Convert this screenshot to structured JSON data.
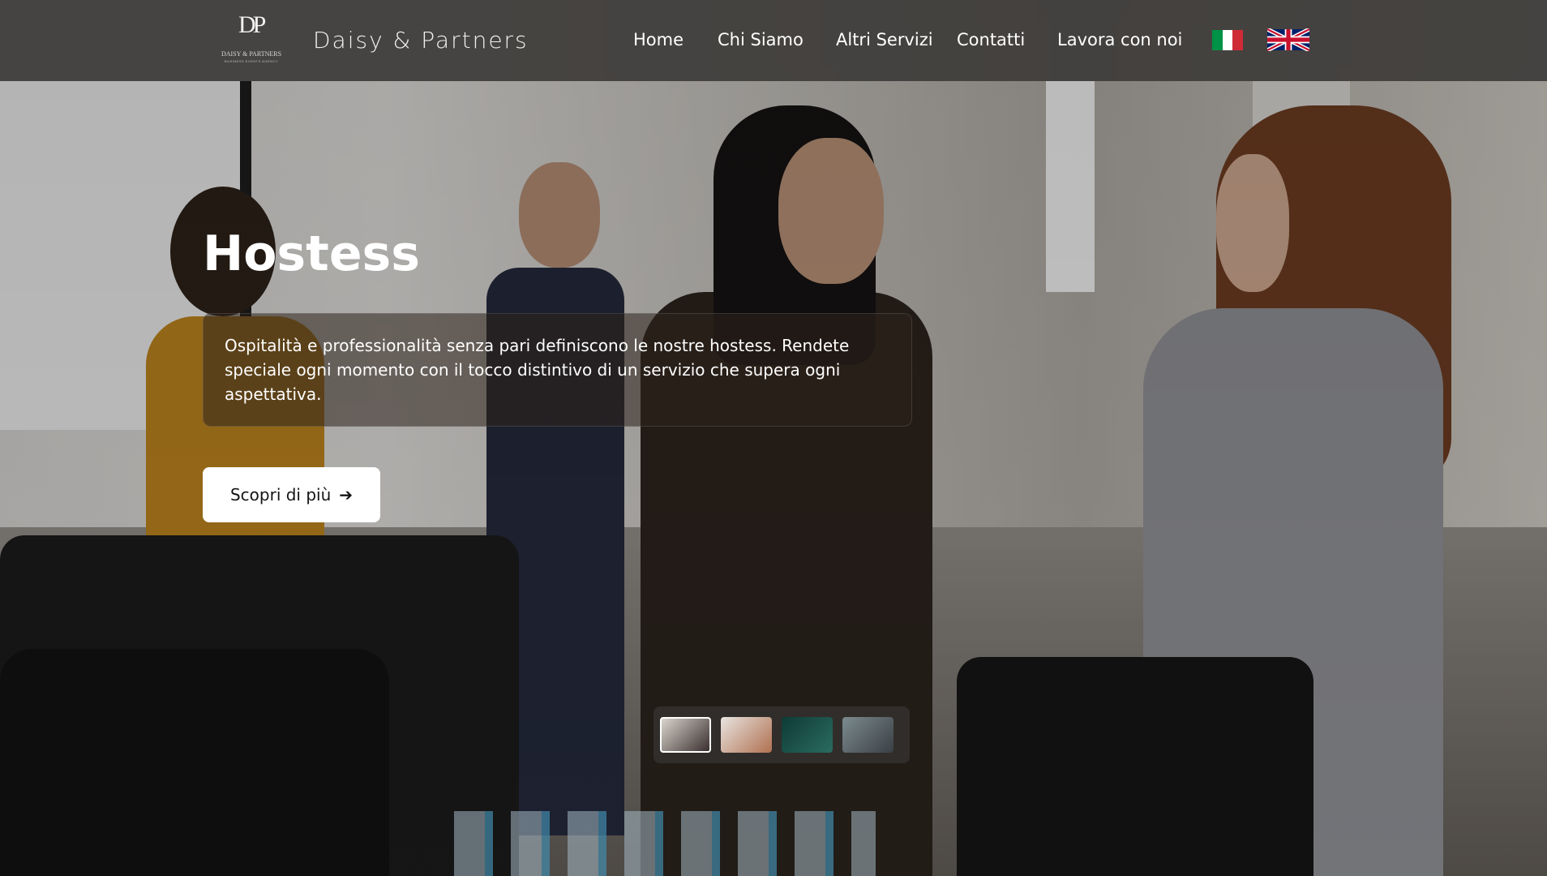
{
  "header": {
    "logo_mono": "DP",
    "logo_tag_main": "DAISY & PARTNERS",
    "logo_tag_sub": "BUSINESS EVENTS AGENCY",
    "brand_name": "Daisy & Partners",
    "nav": [
      {
        "label": "Home"
      },
      {
        "label": "Chi Siamo"
      },
      {
        "label": "Altri Servizi"
      },
      {
        "label": "Contatti"
      },
      {
        "label": "Lavora con noi"
      }
    ],
    "languages": [
      {
        "icon": "italy-flag-icon",
        "colors": [
          "#009246",
          "#ffffff",
          "#ce2b37"
        ]
      },
      {
        "icon": "uk-flag-icon",
        "colors": [
          "#012169",
          "#ffffff",
          "#c8102e"
        ]
      }
    ]
  },
  "hero": {
    "title": "Hostess",
    "description": "Ospitalità e professionalità senza pari definiscono le nostre hostess. Rendete speciale ogni momento con il tocco distintivo di un servizio che supera ogni aspettativa.",
    "cta_label": "Scopri di più",
    "cta_icon": "arrow-right-icon"
  },
  "slider": {
    "thumbnails": [
      {
        "name": "slide-thumb-hostess",
        "colors": [
          "#d9d4cc",
          "#3a3030"
        ],
        "active": true
      },
      {
        "name": "slide-thumb-mountains",
        "colors": [
          "#e8e4e0",
          "#b07050"
        ],
        "active": false
      },
      {
        "name": "slide-thumb-event-hall",
        "colors": [
          "#0f3b36",
          "#2a6b60"
        ],
        "active": false
      },
      {
        "name": "slide-thumb-crowd",
        "colors": [
          "#7c8a8e",
          "#3a4045"
        ],
        "active": false
      }
    ]
  }
}
